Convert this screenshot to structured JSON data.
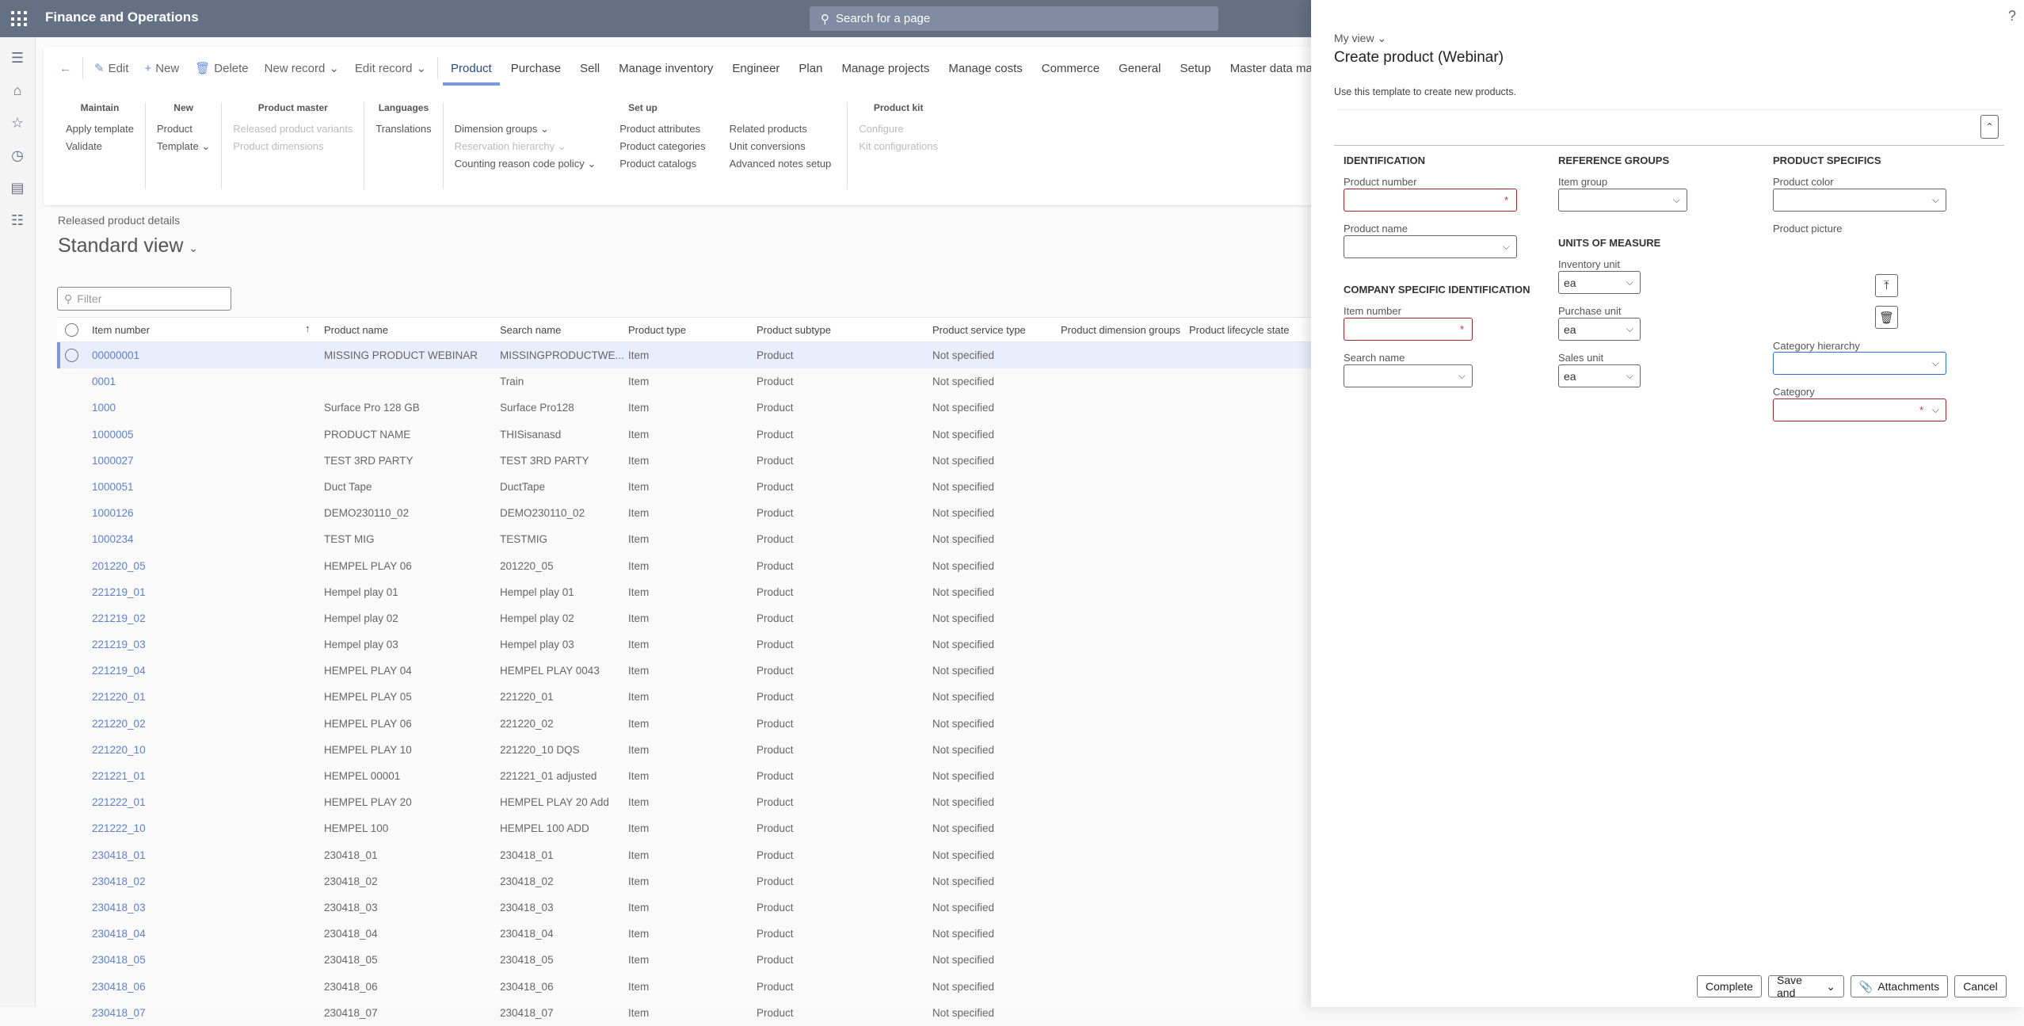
{
  "app": {
    "title": "Finance and Operations",
    "search_placeholder": "Search for a page"
  },
  "leftnav": [
    "hamburger-icon",
    "home-icon",
    "star-icon",
    "clock-icon",
    "workspace-icon",
    "list-icon"
  ],
  "toolbar": {
    "back": "←",
    "edit": "Edit",
    "new": "New",
    "delete": "Delete",
    "new_record": "New record",
    "edit_record": "Edit record",
    "tabs": [
      "Product",
      "Purchase",
      "Sell",
      "Manage inventory",
      "Engineer",
      "Plan",
      "Manage projects",
      "Manage costs",
      "Commerce",
      "General",
      "Setup",
      "Master data management"
    ],
    "active_tab": "Product"
  },
  "ribbon": {
    "maintain": {
      "title": "Maintain",
      "items": [
        "Apply template",
        "Validate"
      ]
    },
    "new": {
      "title": "New",
      "items": [
        "Product",
        "Template"
      ]
    },
    "product_master": {
      "title": "Product master",
      "items": [
        "Released product variants",
        "Product dimensions"
      ]
    },
    "languages": {
      "title": "Languages",
      "items": [
        "Translations"
      ]
    },
    "setup": {
      "title": "Set up",
      "col1": [
        "Dimension groups",
        "Reservation hierarchy",
        "Counting reason code policy"
      ],
      "col2": [
        "Product attributes",
        "Product categories",
        "Product catalogs"
      ],
      "col3": [
        "Related products",
        "Unit conversions",
        "Advanced notes setup"
      ]
    },
    "product_kit": {
      "title": "Product kit",
      "items": [
        "Configure",
        "Kit configurations"
      ]
    }
  },
  "page": {
    "breadcrumb": "Released product details",
    "view_title": "Standard view",
    "filter_placeholder": "Filter"
  },
  "grid": {
    "columns": [
      "Item number",
      "Product name",
      "Search name",
      "Product type",
      "Product subtype",
      "Product service type",
      "Product dimension groups",
      "Product lifecycle state"
    ],
    "rows": [
      [
        "00000001",
        "MISSING PRODUCT WEBINAR",
        "MISSINGPRODUCTWE...",
        "Item",
        "Product",
        "Not specified"
      ],
      [
        "0001",
        "",
        "Train",
        "Item",
        "Product",
        "Not specified"
      ],
      [
        "1000",
        "Surface Pro 128 GB",
        "Surface Pro128",
        "Item",
        "Product",
        "Not specified"
      ],
      [
        "1000005",
        "PRODUCT NAME",
        "THISisanasd",
        "Item",
        "Product",
        "Not specified"
      ],
      [
        "1000027",
        "TEST 3RD PARTY",
        "TEST 3RD PARTY",
        "Item",
        "Product",
        "Not specified"
      ],
      [
        "1000051",
        "Duct Tape",
        "DuctTape",
        "Item",
        "Product",
        "Not specified"
      ],
      [
        "1000126",
        "DEMO230110_02",
        "DEMO230110_02",
        "Item",
        "Product",
        "Not specified"
      ],
      [
        "1000234",
        "TEST MIG",
        "TESTMIG",
        "Item",
        "Product",
        "Not specified"
      ],
      [
        "201220_05",
        "HEMPEL PLAY 06",
        "201220_05",
        "Item",
        "Product",
        "Not specified"
      ],
      [
        "221219_01",
        "Hempel play 01",
        "Hempel play 01",
        "Item",
        "Product",
        "Not specified"
      ],
      [
        "221219_02",
        "Hempel play 02",
        "Hempel play 02",
        "Item",
        "Product",
        "Not specified"
      ],
      [
        "221219_03",
        "Hempel play 03",
        "Hempel play 03",
        "Item",
        "Product",
        "Not specified"
      ],
      [
        "221219_04",
        "HEMPEL PLAY 04",
        "HEMPEL PLAY 0043",
        "Item",
        "Product",
        "Not specified"
      ],
      [
        "221220_01",
        "HEMPEL PLAY 05",
        "221220_01",
        "Item",
        "Product",
        "Not specified"
      ],
      [
        "221220_02",
        "HEMPEL PLAY 06",
        "221220_02",
        "Item",
        "Product",
        "Not specified"
      ],
      [
        "221220_10",
        "HEMPEL PLAY 10",
        "221220_10 DQS",
        "Item",
        "Product",
        "Not specified"
      ],
      [
        "221221_01",
        "HEMPEL 00001",
        "221221_01 adjusted",
        "Item",
        "Product",
        "Not specified"
      ],
      [
        "221222_01",
        "HEMPEL PLAY 20",
        "HEMPEL PLAY 20 Add",
        "Item",
        "Product",
        "Not specified"
      ],
      [
        "221222_10",
        "HEMPEL 100",
        "HEMPEL 100 ADD",
        "Item",
        "Product",
        "Not specified"
      ],
      [
        "230418_01",
        "230418_01",
        "230418_01",
        "Item",
        "Product",
        "Not specified"
      ],
      [
        "230418_02",
        "230418_02",
        "230418_02",
        "Item",
        "Product",
        "Not specified"
      ],
      [
        "230418_03",
        "230418_03",
        "230418_03",
        "Item",
        "Product",
        "Not specified"
      ],
      [
        "230418_04",
        "230418_04",
        "230418_04",
        "Item",
        "Product",
        "Not specified"
      ],
      [
        "230418_05",
        "230418_05",
        "230418_05",
        "Item",
        "Product",
        "Not specified"
      ],
      [
        "230418_06",
        "230418_06",
        "230418_06",
        "Item",
        "Product",
        "Not specified"
      ],
      [
        "230418_07",
        "230418_07",
        "230418_07",
        "Item",
        "Product",
        "Not specified"
      ]
    ]
  },
  "panel": {
    "help": "?",
    "my_view": "My view",
    "title": "Create product (Webinar)",
    "description": "Use this template to create new products.",
    "identification": {
      "title": "IDENTIFICATION",
      "product_number": "Product number",
      "product_name": "Product name"
    },
    "company": {
      "title": "COMPANY SPECIFIC IDENTIFICATION",
      "item_number": "Item number",
      "search_name": "Search name"
    },
    "reference": {
      "title": "REFERENCE GROUPS",
      "item_group": "Item group"
    },
    "units": {
      "title": "UNITS OF MEASURE",
      "inventory_unit": "Inventory unit",
      "inventory_value": "ea",
      "purchase_unit": "Purchase unit",
      "purchase_value": "ea",
      "sales_unit": "Sales unit",
      "sales_value": "ea"
    },
    "specifics": {
      "title": "PRODUCT SPECIFICS",
      "product_color": "Product color",
      "product_picture": "Product picture",
      "category_hierarchy": "Category hierarchy",
      "category": "Category"
    },
    "buttons": {
      "complete": "Complete",
      "save_and": "Save and",
      "attachments": "Attachments",
      "cancel": "Cancel"
    }
  },
  "colors": {
    "header": "#647083",
    "accent": "#7898e0",
    "link": "#5b7fd6",
    "required": "#a4262c"
  }
}
